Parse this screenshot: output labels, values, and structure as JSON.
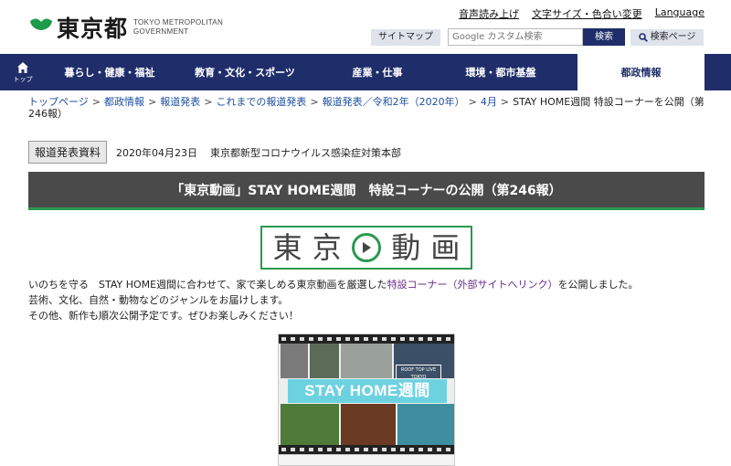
{
  "header": {
    "logo_jp": "東京都",
    "logo_en_line1": "TOKYO METROPOLITAN",
    "logo_en_line2": "GOVERNMENT",
    "utility_links": [
      "音声読み上げ",
      "文字サイズ・色合い変更",
      "Language"
    ],
    "sitemap_label": "サイトマップ",
    "search_placeholder": "Google カスタム検索",
    "search_label": "検索",
    "search_page_label": "検索ページ"
  },
  "nav": {
    "home_label": "トップ",
    "items": [
      "暮らし・健康・福祉",
      "教育・文化・スポーツ",
      "産業・仕事",
      "環境・都市基盤",
      "都政情報"
    ]
  },
  "breadcrumb": {
    "links": [
      "トップページ",
      "都政情報",
      "報道発表",
      "これまでの報道発表",
      "報道発表／令和2年（2020年）",
      "4月"
    ],
    "current": "STAY HOME週間 特設コーナーを公開（第246報）"
  },
  "press": {
    "badge": "報道発表資料",
    "date": "2020年04月23日",
    "department": "東京都新型コロナウイルス感染症対策本部"
  },
  "title": "「東京動画」STAY HOME週間　特設コーナーの公開（第246報）",
  "video_logo": [
    "東",
    "京",
    "動",
    "画"
  ],
  "body": {
    "line1_before": "いのちを守る　STAY HOME週間に合わせて、家で楽しめる東京動画を厳選した",
    "line1_link": "特設コーナー（外部サイトへリンク）",
    "line1_after": "を公開しました。",
    "line2": "芸術、文化、自然・動物などのジャンルをお届けします。",
    "line3": "その他、新作も順次公開予定です。ぜひお楽しみください！"
  },
  "banner": {
    "headline": "STAY HOME週間",
    "rooftop": "ROOF TOP LIVE TOKYO"
  },
  "colors": {
    "nav_bg": "#1f2e6a",
    "accent_green": "#2a9a4e",
    "title_bg": "#4a4a4a",
    "link_blue": "#1f4fa0"
  }
}
